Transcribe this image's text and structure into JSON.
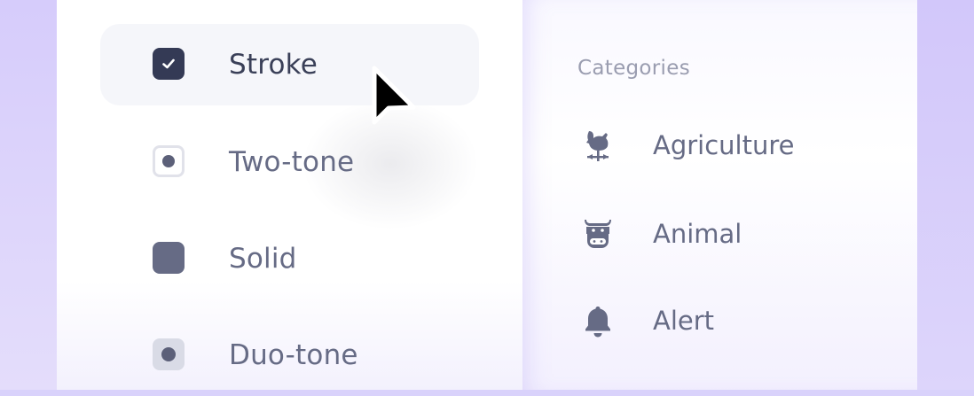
{
  "styles": {
    "options": [
      {
        "label": "Stroke",
        "selected": true
      },
      {
        "label": "Two-tone",
        "selected": false
      },
      {
        "label": "Solid",
        "selected": false
      },
      {
        "label": "Duo-tone",
        "selected": false
      }
    ]
  },
  "categories": {
    "heading": "Categories",
    "items": [
      {
        "label": "Agriculture",
        "icon": "rooster-weathervane-icon"
      },
      {
        "label": "Animal",
        "icon": "cow-icon"
      },
      {
        "label": "Alert",
        "icon": "bell-icon"
      }
    ]
  },
  "colors": {
    "selected_text": "#3a4058",
    "text": "#666b85",
    "muted": "#9a9db0",
    "accent_bg": "#d9d2fb"
  }
}
